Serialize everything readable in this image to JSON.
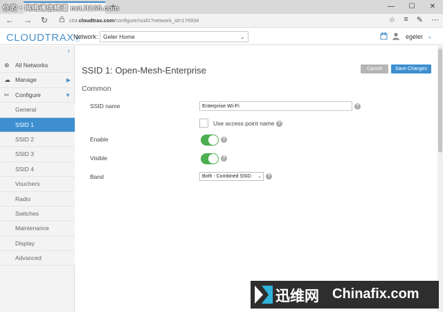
{
  "browser": {
    "watermark_text": "你的・网络通信频道 net.it168.com",
    "tab_close": "×",
    "new_tab": "+",
    "window_controls": [
      "—",
      "☐",
      "✕"
    ],
    "nav_back": "←",
    "nav_forward": "→",
    "nav_refresh": "↻",
    "url_host": "cloudtrax.com",
    "url_prefix": "ctst.",
    "url_path": "/configure/ssid1?network_id=176934",
    "toolbar_icons": [
      "☆",
      "≡",
      "✎",
      "⋯"
    ]
  },
  "header": {
    "logo": "CLOUDTRAX",
    "network_label": "Network:",
    "network_value": "Geler Home",
    "user_name": "egeler",
    "accent_color": "#4a90c9"
  },
  "sidebar": {
    "collapse": "‹",
    "items": [
      {
        "label": "All Networks",
        "icon": "globe-icon"
      },
      {
        "label": "Manage",
        "icon": "cloud-icon"
      },
      {
        "label": "Configure",
        "icon": "tools-icon"
      },
      {
        "label": "General"
      },
      {
        "label": "SSID 1",
        "active": true
      },
      {
        "label": "SSID 2"
      },
      {
        "label": "SSID 3"
      },
      {
        "label": "SSID 4"
      },
      {
        "label": "Vouchers"
      },
      {
        "label": "Radio"
      },
      {
        "label": "Switches"
      },
      {
        "label": "Maintenance"
      },
      {
        "label": "Display"
      },
      {
        "label": "Advanced"
      }
    ],
    "active_color": "#3d8fd0"
  },
  "main": {
    "title": "SSID 1: Open-Mesh-Enterprise",
    "cancel_label": "Cancel",
    "save_label": "Save Changes",
    "section": "Common",
    "ssid_name_label": "SSID name",
    "ssid_name_value": "Enterprise Wi-Fi",
    "use_ap_name_label": "Use access point name",
    "enable_label": "Enable",
    "visible_label": "Visible",
    "band_label": "Band",
    "band_value": "Both - Combined SSID",
    "help_glyph": "?",
    "toggle_color": "#4caf50"
  },
  "watermark": {
    "cn": "迅维网",
    "en": "Chinafix.com"
  }
}
